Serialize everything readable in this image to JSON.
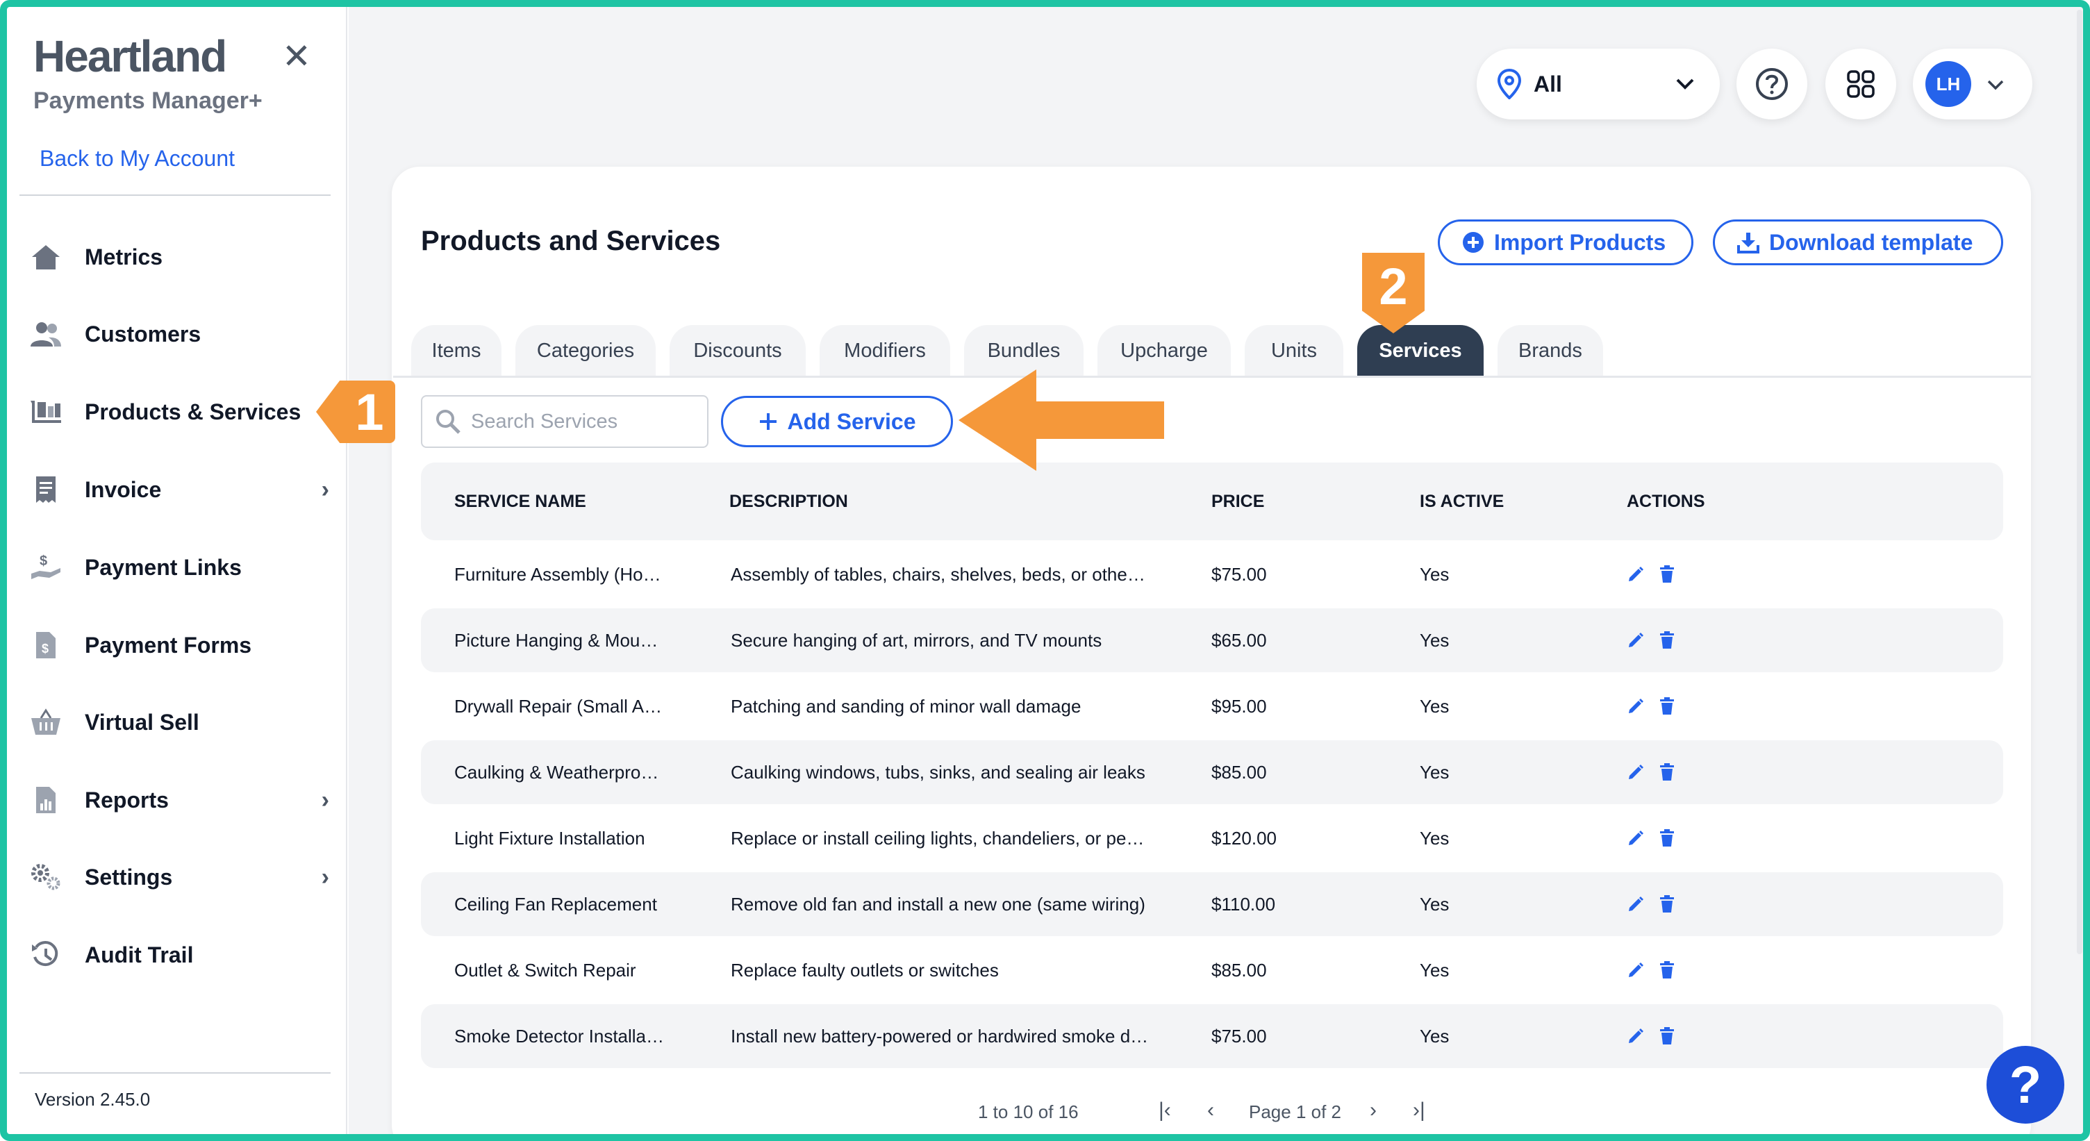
{
  "brand": {
    "name": "Heartland",
    "subtitle": "Payments Manager+",
    "back_link": "Back to My Account"
  },
  "sidebar": {
    "items": [
      {
        "label": "Metrics",
        "icon": "home-icon"
      },
      {
        "label": "Customers",
        "icon": "users-icon"
      },
      {
        "label": "Products & Services",
        "icon": "products-icon"
      },
      {
        "label": "Invoice",
        "icon": "invoice-icon"
      },
      {
        "label": "Payment Links",
        "icon": "payment-link-icon"
      },
      {
        "label": "Payment Forms",
        "icon": "payment-form-icon"
      },
      {
        "label": "Virtual Sell",
        "icon": "basket-icon"
      },
      {
        "label": "Reports",
        "icon": "reports-icon"
      },
      {
        "label": "Settings",
        "icon": "gear-icon"
      },
      {
        "label": "Audit Trail",
        "icon": "history-icon"
      }
    ],
    "version": "Version 2.45.0"
  },
  "callouts": {
    "one": "1",
    "two": "2"
  },
  "header": {
    "location": "All",
    "avatar_initials": "LH"
  },
  "page": {
    "title": "Products and Services",
    "import_label": "Import Products",
    "download_label": "Download template",
    "tabs": [
      "Items",
      "Categories",
      "Discounts",
      "Modifiers",
      "Bundles",
      "Upcharge",
      "Units",
      "Services",
      "Brands"
    ],
    "active_tab": "Services",
    "search_placeholder": "Search Services",
    "add_label": "Add Service"
  },
  "table": {
    "headers": [
      "SERVICE NAME",
      "DESCRIPTION",
      "PRICE",
      "IS ACTIVE",
      "ACTIONS"
    ],
    "rows": [
      {
        "name": "Furniture Assembly (Ho…",
        "description": "Assembly of tables, chairs, shelves, beds, or othe…",
        "price": "$75.00",
        "active": "Yes"
      },
      {
        "name": "Picture Hanging & Mou…",
        "description": "Secure hanging of art, mirrors, and TV mounts",
        "price": "$65.00",
        "active": "Yes"
      },
      {
        "name": "Drywall Repair (Small A…",
        "description": "Patching and sanding of minor wall damage",
        "price": "$95.00",
        "active": "Yes"
      },
      {
        "name": "Caulking & Weatherpro…",
        "description": "Caulking windows, tubs, sinks, and sealing air leaks",
        "price": "$85.00",
        "active": "Yes"
      },
      {
        "name": "Light Fixture Installation",
        "description": "Replace or install ceiling lights, chandeliers, or pe…",
        "price": "$120.00",
        "active": "Yes"
      },
      {
        "name": "Ceiling Fan Replacement",
        "description": "Remove old fan and install a new one (same wiring)",
        "price": "$110.00",
        "active": "Yes"
      },
      {
        "name": "Outlet & Switch Repair",
        "description": "Replace faulty outlets or switches",
        "price": "$85.00",
        "active": "Yes"
      },
      {
        "name": "Smoke Detector Installa…",
        "description": "Install new battery-powered or hardwired smoke d…",
        "price": "$75.00",
        "active": "Yes"
      }
    ]
  },
  "pagination": {
    "range": "1 to 10 of 16",
    "page": "Page 1 of 2"
  },
  "colors": {
    "accent": "#2563eb",
    "active_tab": "#2f3e52",
    "callout": "#f5983a",
    "frame": "#1ec4a4"
  }
}
